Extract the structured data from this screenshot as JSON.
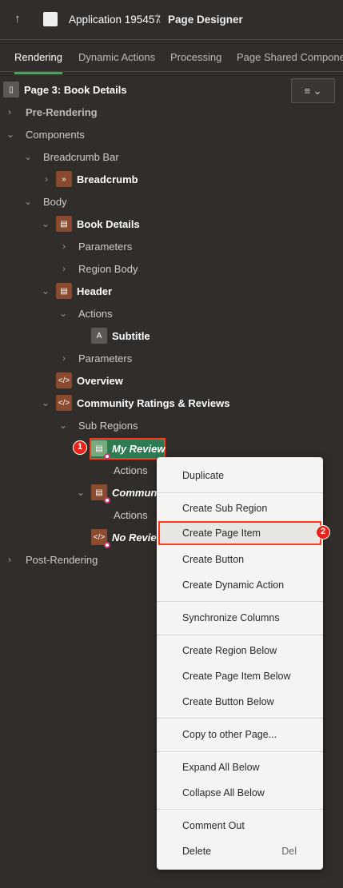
{
  "header": {
    "app": "Application 195457",
    "page": "Page Designer"
  },
  "tabs": [
    "Rendering",
    "Dynamic Actions",
    "Processing",
    "Page Shared Componen"
  ],
  "tree": {
    "page": "Page 3: Book Details",
    "pre": "Pre-Rendering",
    "components": "Components",
    "breadcrumb_bar": "Breadcrumb Bar",
    "breadcrumb": "Breadcrumb",
    "body": "Body",
    "book_details": "Book Details",
    "parameters": "Parameters",
    "region_body": "Region Body",
    "header": "Header",
    "actions": "Actions",
    "subtitle": "Subtitle",
    "overview": "Overview",
    "community": "Community Ratings & Reviews",
    "sub_regions": "Sub Regions",
    "my_review": "My Review",
    "community_short": "Communit",
    "no_review": "No Review",
    "post": "Post-Rendering"
  },
  "badges": [
    "1",
    "2"
  ],
  "context_menu": [
    {
      "label": "Duplicate"
    },
    {
      "label": "Create Sub Region"
    },
    {
      "label": "Create Page Item"
    },
    {
      "label": "Create Button"
    },
    {
      "label": "Create Dynamic Action"
    },
    {
      "label": "Synchronize Columns"
    },
    {
      "label": "Create Region Below"
    },
    {
      "label": "Create Page Item Below"
    },
    {
      "label": "Create Button Below"
    },
    {
      "label": "Copy to other Page..."
    },
    {
      "label": "Expand All Below"
    },
    {
      "label": "Collapse All Below"
    },
    {
      "label": "Comment Out"
    },
    {
      "label": "Delete",
      "shortcut": "Del"
    }
  ]
}
